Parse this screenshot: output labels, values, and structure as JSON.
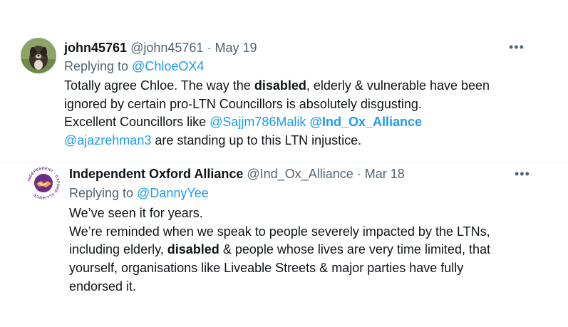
{
  "tweets": [
    {
      "display_name": "john45761",
      "handle": "@john45761",
      "separator": "·",
      "date": "May 19",
      "replying_prefix": "Replying to",
      "replying_to": "@ChloeOX4",
      "more_label": "•••",
      "avatar_icon": "dog-photo-avatar",
      "lines": {
        "l1_a": "Totally agree Chloe. The way the",
        "l1_b": "disabled",
        "l1_c": ", elderly & vulnerable have been",
        "l2": "ignored by certain pro-LTN Councillors is absolutely disgusting.",
        "l3_a": "Excellent Councillors like",
        "l3_m1": "@Sajjm786Malik",
        "l3_m2": "@Ind_Ox_Alliance",
        "l4_m": "@ajazrehman3",
        "l4_b": "are standing up to this LTN injustice."
      }
    },
    {
      "display_name": "Independent Oxford Alliance",
      "handle": "@Ind_Ox_Alliance",
      "separator": "·",
      "date": "Mar 18",
      "replying_prefix": "Replying to",
      "replying_to": "@DannyYee",
      "more_label": "•••",
      "avatar_icon": "handshake-logo-avatar",
      "logo_text": "INDEPENDENT OXFORD ALLIANCE",
      "lines": {
        "l1": "We’ve seen it for years.",
        "l2": "We’re reminded when we speak to people severely impacted by the LTNs,",
        "l3_a": "including elderly,",
        "l3_b": "disabled",
        "l3_c": "& people whose lives are very time limited, that",
        "l4": "yourself, organisations like Liveable Streets & major parties have fully",
        "l5": "endorsed it."
      }
    }
  ]
}
